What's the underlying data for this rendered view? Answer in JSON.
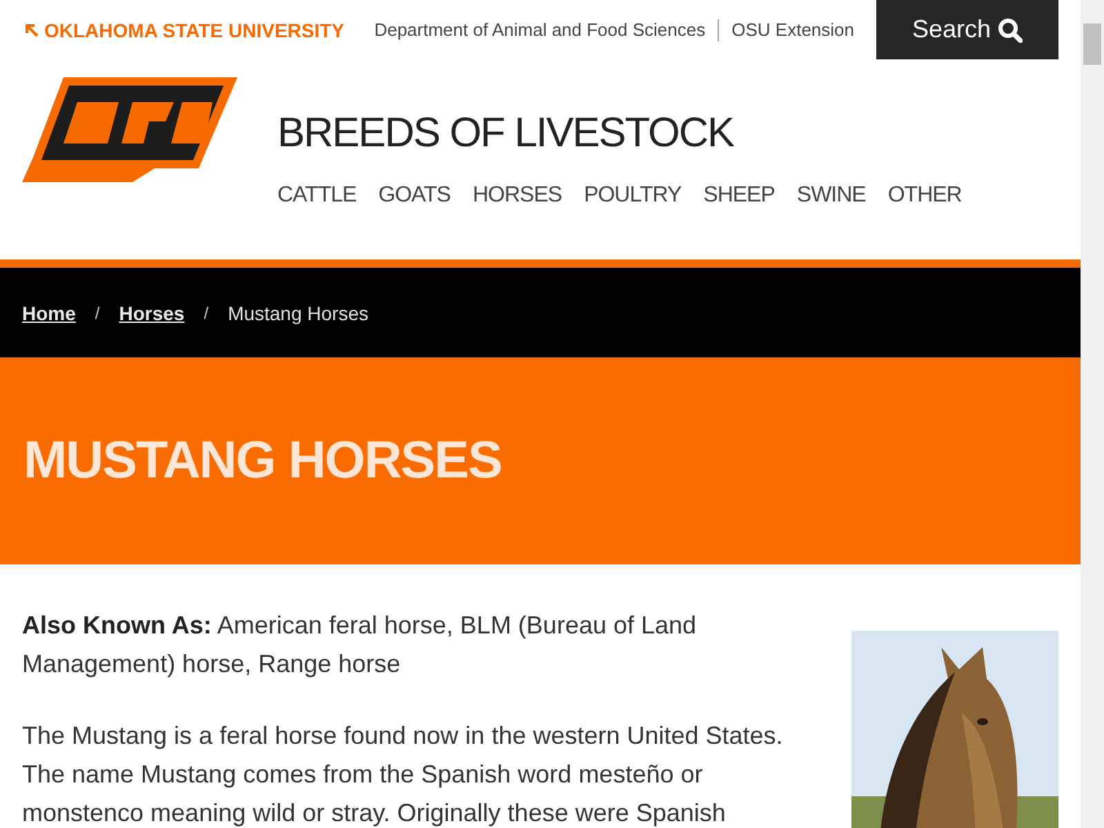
{
  "topbar": {
    "university_link": "OKLAHOMA STATE UNIVERSITY",
    "links": [
      "Department of Animal and Food Sciences",
      "OSU Extension"
    ],
    "search_button": "Search"
  },
  "header": {
    "site_title": "BREEDS OF LIVESTOCK",
    "nav": [
      {
        "label": "CATTLE"
      },
      {
        "label": "GOATS"
      },
      {
        "label": "HORSES"
      },
      {
        "label": "POULTRY"
      },
      {
        "label": "SHEEP"
      },
      {
        "label": "SWINE"
      },
      {
        "label": "OTHER"
      }
    ]
  },
  "breadcrumb": [
    {
      "label": "Home",
      "kind": "link"
    },
    {
      "label": "/",
      "kind": "separator"
    },
    {
      "label": "Horses",
      "kind": "link"
    },
    {
      "label": "/",
      "kind": "separator"
    },
    {
      "label": "Mustang Horses",
      "kind": "current"
    }
  ],
  "page_title": "MUSTANG HORSES",
  "content": {
    "paragraphs": [
      "**Also Known As:** American feral horse, BLM (Bureau of Land Management) horse, Range horse",
      "The Mustang is a feral horse found now in the western United States. The name Mustang comes from the Spanish word mesteño or monstenco meaning wild or stray. Originally these were Spanish"
    ]
  }
}
